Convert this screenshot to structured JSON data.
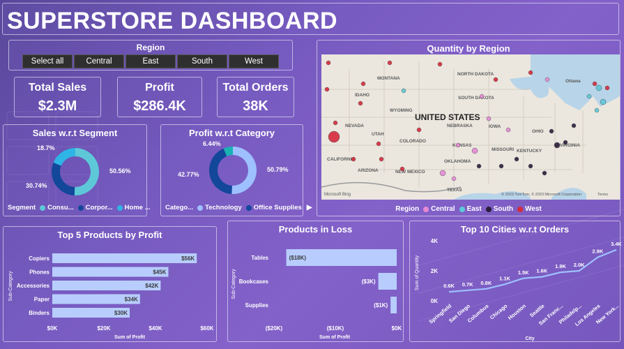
{
  "title": "SUPERSTORE DASHBOARD",
  "region_slicer": {
    "title": "Region",
    "options": [
      "Select all",
      "Central",
      "East",
      "South",
      "West"
    ]
  },
  "kpis": [
    {
      "label": "Total Sales",
      "value": "$2.3M"
    },
    {
      "label": "Profit",
      "value": "$286.4K"
    },
    {
      "label": "Total Orders",
      "value": "38K"
    }
  ],
  "segment_chart": {
    "title": "Sales w.r.t Segment",
    "legend_title": "Segment",
    "legend_items": [
      "Consu...",
      "Corpor...",
      "Home ..."
    ],
    "labels": [
      "50.56%",
      "30.74%",
      "18.7%"
    ]
  },
  "category_chart": {
    "title": "Profit w.r.t Category",
    "legend_title": "Catego...",
    "legend_items": [
      "Technology",
      "Office Supplies"
    ],
    "labels": [
      "50.79%",
      "42.77%",
      "6.44%"
    ]
  },
  "map": {
    "title": "Quantity by Region",
    "country_label": "UNITED STATES",
    "states": [
      "MONTANA",
      "NORTH DAKOTA",
      "SOUTH DAKOTA",
      "IDAHO",
      "WYOMING",
      "NEVADA",
      "UTAH",
      "COLORADO",
      "CALIFORNIA",
      "ARIZONA",
      "NEW MEXICO",
      "OKLAHOMA",
      "TEXAS",
      "KANSAS",
      "IOWA",
      "NEBRASKA",
      "MISSOURI",
      "KENTUCKY",
      "OHIO",
      "VIRGINIA"
    ],
    "ocean_label": "Ottawa",
    "attribution": "© 2023 TomTom, © 2023 Microsoft Corporation",
    "terms": "Terms",
    "brand": "Microsoft Bing",
    "legend_title": "Region",
    "legend_items": [
      "Central",
      "East",
      "South",
      "West"
    ]
  },
  "colors": {
    "segment": [
      "#5ec8d8",
      "#12479a",
      "#2fb4e6"
    ],
    "category": [
      "#9ec0ff",
      "#12479a",
      "#19b3b3"
    ],
    "region": {
      "Central": "#e58ad6",
      "East": "#5ec8d8",
      "South": "#2a1d3a",
      "West": "#d62a3a"
    },
    "bar": "#b8cdfd",
    "line": "#9ec0ff"
  },
  "top_products": {
    "title": "Top 5 Products by Profit",
    "ylabel": "Sub-Category",
    "xlabel": "Sum of Profit",
    "x_ticks": [
      "$0K",
      "$20K",
      "$40K",
      "$60K"
    ],
    "chart_data": {
      "type": "bar",
      "categories": [
        "Copiers",
        "Phones",
        "Accessories",
        "Paper",
        "Binders"
      ],
      "values": [
        56,
        45,
        42,
        34,
        30
      ],
      "value_labels": [
        "$56K",
        "$45K",
        "$42K",
        "$34K",
        "$30K"
      ],
      "xlim": [
        0,
        60
      ]
    }
  },
  "loss_products": {
    "title": "Products in Loss",
    "ylabel": "Sub-Category",
    "xlabel": "Sum of Profit",
    "x_ticks": [
      "($20K)",
      "($10K)",
      "$0K"
    ],
    "chart_data": {
      "type": "bar",
      "categories": [
        "Tables",
        "Bookcases",
        "Supplies"
      ],
      "values": [
        -18,
        -3,
        -1
      ],
      "value_labels": [
        "($18K)",
        "($3K)",
        "($1K)"
      ],
      "xlim": [
        -20,
        0
      ]
    }
  },
  "top_cities": {
    "title": "Top 10 Cities w.r.t Orders",
    "ylabel": "Sum of Quantity",
    "xlabel": "City",
    "y_ticks": [
      "0K",
      "2K",
      "4K"
    ],
    "chart_data": {
      "type": "line",
      "categories": [
        "Springfield",
        "San Diego",
        "Columbus",
        "Chicago",
        "Houston",
        "Seattle",
        "San Franc...",
        "Philadelp...",
        "Los Angeles",
        "New York..."
      ],
      "values": [
        0.6,
        0.6,
        0.7,
        0.8,
        1.1,
        1.5,
        1.6,
        1.9,
        2.0,
        2.9,
        3.4
      ],
      "points": [
        0.6,
        0.7,
        0.8,
        1.1,
        1.5,
        1.6,
        1.9,
        2.0,
        2.9,
        3.4
      ],
      "value_labels": [
        "0.6K",
        "0.7K",
        "0.8K",
        "1.1K",
        "1.5K",
        "1.6K",
        "1.9K",
        "2.0K",
        "2.9K",
        "3.4K"
      ],
      "ylim": [
        0,
        4
      ]
    }
  }
}
